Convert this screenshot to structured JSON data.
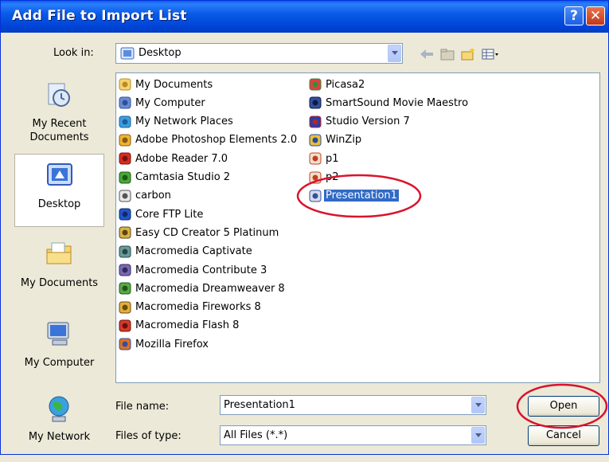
{
  "window": {
    "title": "Add File to Import List",
    "help_glyph": "?",
    "close_glyph": "✕"
  },
  "look_in": {
    "label": "Look in:",
    "value": "Desktop"
  },
  "places": [
    {
      "label": "My Recent Documents"
    },
    {
      "label": "Desktop"
    },
    {
      "label": "My Documents"
    },
    {
      "label": "My Computer"
    },
    {
      "label": "My Network"
    }
  ],
  "files": [
    {
      "name": "My Documents",
      "icon": "folder-icon"
    },
    {
      "name": "My Computer",
      "icon": "computer-icon"
    },
    {
      "name": "My Network Places",
      "icon": "network-icon"
    },
    {
      "name": "Adobe Photoshop Elements 2.0",
      "icon": "photoshop-icon"
    },
    {
      "name": "Adobe Reader 7.0",
      "icon": "acrobat-icon"
    },
    {
      "name": "Camtasia Studio 2",
      "icon": "camtasia-icon"
    },
    {
      "name": "carbon",
      "icon": "app-icon"
    },
    {
      "name": "Core FTP Lite",
      "icon": "ftp-icon"
    },
    {
      "name": "Easy CD Creator 5 Platinum",
      "icon": "cd-creator-icon"
    },
    {
      "name": "Macromedia Captivate",
      "icon": "captivate-icon"
    },
    {
      "name": "Macromedia Contribute 3",
      "icon": "contribute-icon"
    },
    {
      "name": "Macromedia Dreamweaver 8",
      "icon": "dreamweaver-icon"
    },
    {
      "name": "Macromedia Fireworks 8",
      "icon": "fireworks-icon"
    },
    {
      "name": "Macromedia Flash 8",
      "icon": "flash-icon"
    },
    {
      "name": "Mozilla Firefox",
      "icon": "firefox-icon"
    },
    {
      "name": "Picasa2",
      "icon": "picasa-icon"
    },
    {
      "name": "SmartSound Movie Maestro",
      "icon": "smartsound-icon"
    },
    {
      "name": "Studio Version 7",
      "icon": "studio-icon"
    },
    {
      "name": "WinZip",
      "icon": "winzip-icon"
    },
    {
      "name": "p1",
      "icon": "powerpoint-icon"
    },
    {
      "name": "p2",
      "icon": "powerpoint-icon"
    },
    {
      "name": "Presentation1",
      "icon": "presentation-icon",
      "selected": true
    }
  ],
  "file_name": {
    "label": "File name:",
    "value": "Presentation1"
  },
  "file_type": {
    "label": "Files of type:",
    "value": "All Files (*.*)"
  },
  "buttons": {
    "open": "Open",
    "cancel": "Cancel"
  },
  "colors": {
    "title_bar": "#0a5be8",
    "selection": "#316ac5",
    "annotation_circle": "#d9142c"
  }
}
